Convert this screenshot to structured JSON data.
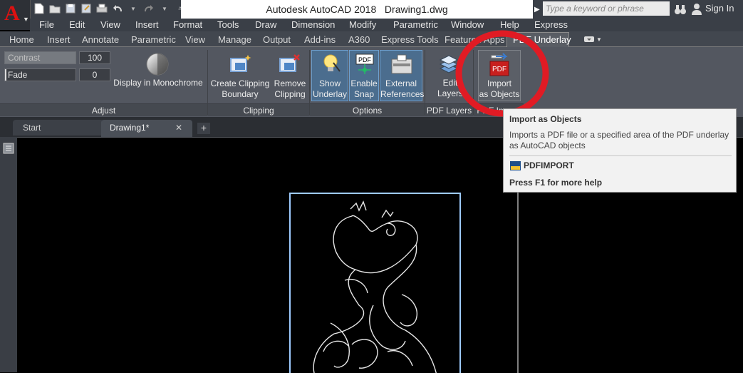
{
  "titlebar": {
    "app_title": "Autodesk AutoCAD 2018",
    "document_name": "Drawing1.dwg",
    "search_placeholder": "Type a keyword or phrase",
    "sign_in": "Sign In"
  },
  "menu": [
    "File",
    "Edit",
    "View",
    "Insert",
    "Format",
    "Tools",
    "Draw",
    "Dimension",
    "Modify",
    "Parametric",
    "Window",
    "Help",
    "Express"
  ],
  "ribbon_tabs": [
    "Home",
    "Insert",
    "Annotate",
    "Parametric",
    "View",
    "Manage",
    "Output",
    "Add-ins",
    "A360",
    "Express Tools",
    "Featured Apps",
    "PDF Underlay"
  ],
  "active_tab": "PDF Underlay",
  "adjust": {
    "contrast_label": "Contrast",
    "contrast_value": "100",
    "fade_label": "Fade",
    "fade_value": "0",
    "monochrome_label": "Display in Monochrome",
    "panel_title": "Adjust"
  },
  "clipping": {
    "create_label_1": "Create Clipping",
    "create_label_2": "Boundary",
    "remove_label_1": "Remove",
    "remove_label_2": "Clipping",
    "panel_title": "Clipping"
  },
  "options": {
    "show_label_1": "Show",
    "show_label_2": "Underlay",
    "snap_label_1": "Enable",
    "snap_label_2": "Snap",
    "xref_label_1": "External",
    "xref_label_2": "References",
    "panel_title": "Options"
  },
  "pdf_layers": {
    "edit_label_1": "Edit",
    "edit_label_2": "Layers",
    "panel_title": "PDF Layers"
  },
  "pdf_import": {
    "import_label_1": "Import",
    "import_label_2": "as Objects",
    "panel_title": "PDF Import",
    "icon_text": "PDF"
  },
  "tooltip": {
    "title": "Import as Objects",
    "description": "Imports a PDF file or a specified area of the PDF underlay as AutoCAD objects",
    "command": "PDFIMPORT",
    "help": "Press F1 for more help"
  },
  "doc_tabs": {
    "start": "Start",
    "drawing": "Drawing1*",
    "close": "✕",
    "plus": "+"
  },
  "colors": {
    "highlight_circle": "#e01b24",
    "underlay_frame": "#9ecbff"
  }
}
